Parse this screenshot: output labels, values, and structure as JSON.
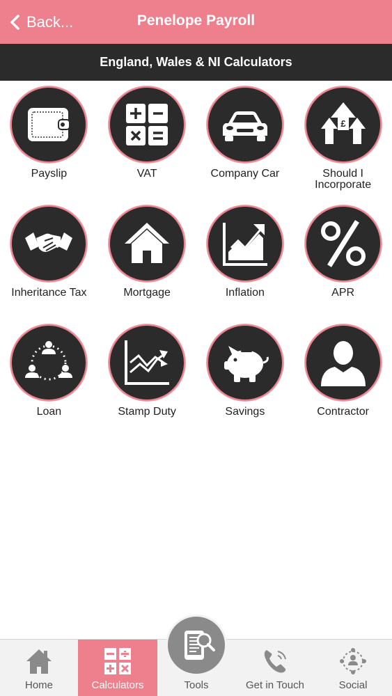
{
  "header": {
    "back_label": "Back...",
    "title": "Penelope Payroll",
    "back_icon": "chevron-left-icon"
  },
  "subheader": {
    "title": "England, Wales & NI Calculators"
  },
  "calculators": [
    {
      "label": "Payslip",
      "icon": "wallet-icon"
    },
    {
      "label": "VAT",
      "icon": "calculator-icon"
    },
    {
      "label": "Company Car",
      "icon": "car-icon"
    },
    {
      "label": "Should I Incorporate",
      "icon": "pound-growth-arrows-icon"
    },
    {
      "label": "Inheritance Tax",
      "icon": "handshake-icon"
    },
    {
      "label": "Mortgage",
      "icon": "house-icon"
    },
    {
      "label": "Inflation",
      "icon": "rising-chart-icon"
    },
    {
      "label": "APR",
      "icon": "percent-icon"
    },
    {
      "label": "Loan",
      "icon": "people-cycle-icon"
    },
    {
      "label": "Stamp Duty",
      "icon": "zigzag-chart-icon"
    },
    {
      "label": "Savings",
      "icon": "piggy-bank-icon"
    },
    {
      "label": "Contractor",
      "icon": "person-silhouette-icon"
    }
  ],
  "tabs": [
    {
      "label": "Home",
      "icon": "home-icon"
    },
    {
      "label": "Calculators",
      "icon": "calculator-icon"
    },
    {
      "label": "Tools",
      "icon": "document-search-icon"
    },
    {
      "label": "Get in Touch",
      "icon": "phone-icon"
    },
    {
      "label": "Social",
      "icon": "network-icon"
    }
  ],
  "colors": {
    "accent": "#ee7f8d",
    "dark": "#2b2b2b",
    "tab_bg": "#f2f2f2"
  }
}
